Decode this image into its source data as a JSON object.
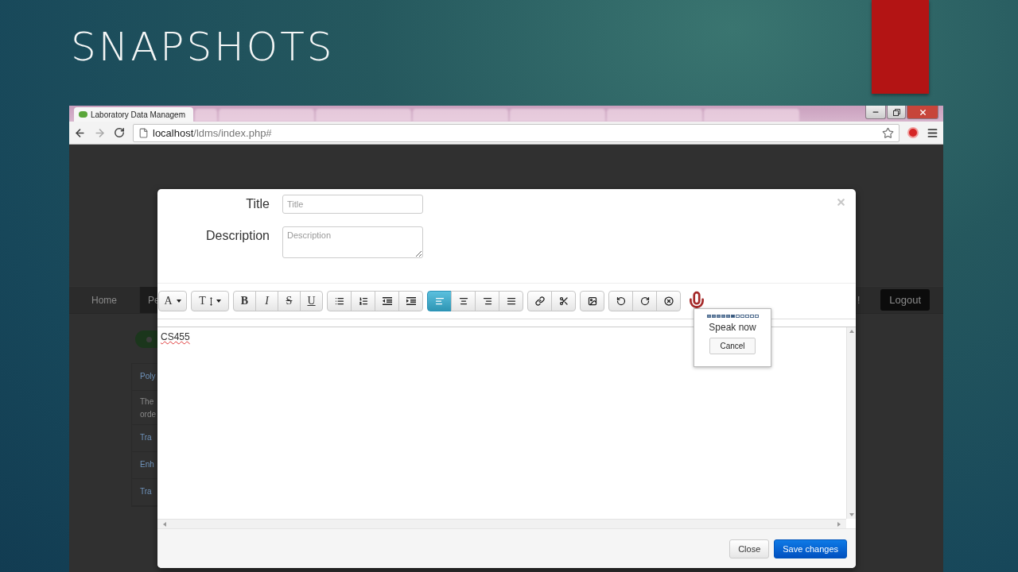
{
  "slide": {
    "title": "SNAPSHOTS"
  },
  "browser": {
    "active_tab": {
      "title": "Laboratory Data Managem"
    },
    "address": {
      "host": "localhost",
      "path": "/ldms/index.php#"
    }
  },
  "background_page": {
    "nav": [
      {
        "label": "Home",
        "selected": false
      },
      {
        "label": "Pe",
        "selected": true
      }
    ],
    "nav_mark": "!",
    "logout": "Logout",
    "list": [
      {
        "kind": "link",
        "lines": [
          "Poly"
        ]
      },
      {
        "kind": "text",
        "lines": [
          "The",
          "orde"
        ]
      },
      {
        "kind": "link",
        "lines": [
          "Tra"
        ]
      },
      {
        "kind": "link",
        "lines": [
          "Enh"
        ]
      },
      {
        "kind": "link",
        "lines": [
          "Tra"
        ]
      }
    ]
  },
  "modal": {
    "fields": [
      {
        "kind": "input",
        "label": "Title",
        "placeholder": "Title"
      },
      {
        "kind": "textarea",
        "label": "Description",
        "placeholder": "Description"
      }
    ],
    "toolbar": [
      [
        {
          "kind": "font",
          "glyph": "A",
          "active": false
        }
      ],
      [
        {
          "kind": "size",
          "glyph": "T",
          "active": false
        }
      ],
      [
        {
          "kind": "bold",
          "glyph": "B",
          "active": false
        },
        {
          "kind": "italic",
          "glyph": "I",
          "active": false
        },
        {
          "kind": "strike",
          "glyph": "S",
          "active": false
        },
        {
          "kind": "underline",
          "glyph": "U",
          "active": false
        }
      ],
      [
        {
          "kind": "bullets",
          "active": false
        },
        {
          "kind": "numbers",
          "active": false
        },
        {
          "kind": "outdent",
          "active": false
        },
        {
          "kind": "indent",
          "active": false
        }
      ],
      [
        {
          "kind": "align-left",
          "active": true
        },
        {
          "kind": "align-center",
          "active": false
        },
        {
          "kind": "align-right",
          "active": false
        },
        {
          "kind": "justify",
          "active": false
        }
      ],
      [
        {
          "kind": "link",
          "active": false
        },
        {
          "kind": "unlink",
          "active": false
        }
      ],
      [
        {
          "kind": "image",
          "active": false
        }
      ],
      [
        {
          "kind": "undo",
          "active": false
        },
        {
          "kind": "redo",
          "active": false
        },
        {
          "kind": "clear",
          "active": false
        }
      ]
    ],
    "editor": {
      "text": "CS455"
    },
    "speech": {
      "level": 0.55,
      "prompt": "Speak now",
      "cancel": "Cancel"
    },
    "buttons": [
      {
        "label": "Close",
        "primary": false
      },
      {
        "label": "Save changes",
        "primary": true
      }
    ]
  }
}
